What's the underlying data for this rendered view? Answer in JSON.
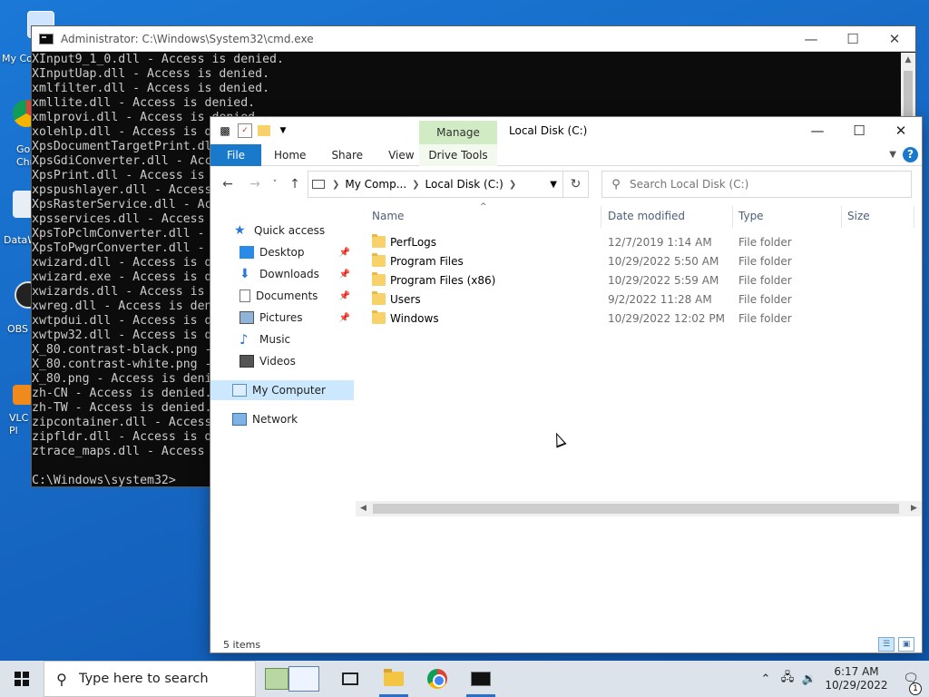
{
  "desktop": {
    "icons": [
      {
        "label": "My Co",
        "icon": "computer-icon"
      },
      {
        "label": "Go\nChr",
        "icon": "chrome-icon"
      },
      {
        "label": "DataW",
        "icon": "app-icon"
      },
      {
        "label": "OBS",
        "icon": "obs-icon"
      },
      {
        "label": "VLC\nPl",
        "icon": "vlc-icon"
      }
    ]
  },
  "cmd": {
    "title": "Administrator: C:\\Windows\\System32\\cmd.exe",
    "lines": [
      "XInput9_1_0.dll - Access is denied.",
      "XInputUap.dll - Access is denied.",
      "xmlfilter.dll - Access is denied.",
      "xmllite.dll - Access is denied.",
      "xmlprovi.dll - Access is denied.",
      "xolehlp.dll - Access is d",
      "XpsDocumentTargetPrint.dl",
      "XpsGdiConverter.dll - Acc",
      "XpsPrint.dll - Access is ",
      "xpspushlayer.dll - Access",
      "XpsRasterService.dll - Ac",
      "xpsservices.dll - Access ",
      "XpsToPclmConverter.dll - ",
      "XpsToPwgrConverter.dll - ",
      "xwizard.dll - Access is d",
      "xwizard.exe - Access is d",
      "xwizards.dll - Access is ",
      "xwreg.dll - Access is den",
      "xwtpdui.dll - Access is d",
      "xwtpw32.dll - Access is d",
      "X_80.contrast-black.png -",
      "X_80.contrast-white.png -",
      "X_80.png - Access is deni",
      "zh-CN - Access is denied.",
      "zh-TW - Access is denied.",
      "zipcontainer.dll - Access",
      "zipfldr.dll - Access is d",
      "ztrace_maps.dll - Access ",
      "",
      "C:\\Windows\\system32>"
    ]
  },
  "explorer": {
    "title": "Local Disk (C:)",
    "manage_label": "Manage",
    "ribbon": {
      "file": "File",
      "home": "Home",
      "share": "Share",
      "view": "View",
      "drive_tools": "Drive Tools"
    },
    "address": {
      "crumbs": [
        "My Comp...",
        "Local Disk (C:)"
      ]
    },
    "search": {
      "placeholder": "Search Local Disk (C:)"
    },
    "nav": {
      "quick_access": "Quick access",
      "desktop": "Desktop",
      "downloads": "Downloads",
      "documents": "Documents",
      "pictures": "Pictures",
      "music": "Music",
      "videos": "Videos",
      "my_computer": "My Computer",
      "network": "Network"
    },
    "columns": {
      "name": "Name",
      "date": "Date modified",
      "type": "Type",
      "size": "Size"
    },
    "rows": [
      {
        "name": "PerfLogs",
        "date": "12/7/2019 1:14 AM",
        "type": "File folder"
      },
      {
        "name": "Program Files",
        "date": "10/29/2022 5:50 AM",
        "type": "File folder"
      },
      {
        "name": "Program Files (x86)",
        "date": "10/29/2022 5:59 AM",
        "type": "File folder"
      },
      {
        "name": "Users",
        "date": "9/2/2022 11:28 AM",
        "type": "File folder"
      },
      {
        "name": "Windows",
        "date": "10/29/2022 12:02 PM",
        "type": "File folder"
      }
    ],
    "status": {
      "count": "5 items"
    }
  },
  "taskbar": {
    "search_placeholder": "Type here to search",
    "time": "6:17 AM",
    "date": "10/29/2022",
    "notification_count": "1"
  },
  "colors": {
    "accent": "#1979ca",
    "manage_tab": "#d1ecc4",
    "selected": "#cce8ff",
    "desktop": "#1565c0"
  }
}
